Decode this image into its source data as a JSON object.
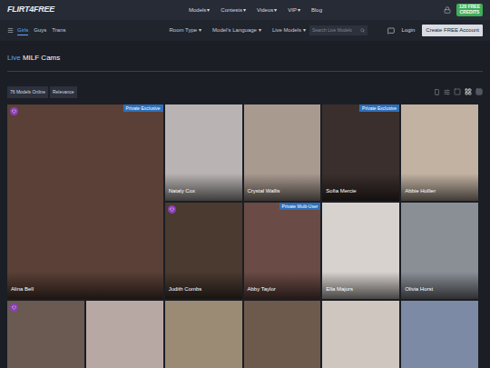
{
  "header": {
    "logo": "FLIRT4FREE",
    "nav": [
      {
        "label": "Models",
        "dropdown": true
      },
      {
        "label": "Contests",
        "dropdown": true
      },
      {
        "label": "Videos",
        "dropdown": true
      },
      {
        "label": "VIP",
        "dropdown": true
      },
      {
        "label": "Blog",
        "dropdown": false
      }
    ],
    "caret": "▾",
    "credits": {
      "amount": "120 FREE",
      "label": "CREDITS"
    }
  },
  "subbar": {
    "categories": [
      {
        "label": "Girls",
        "selected": true
      },
      {
        "label": "Guys",
        "selected": false
      },
      {
        "label": "Trans",
        "selected": false
      }
    ],
    "filters": [
      "Room Type",
      "Model's Language",
      "Live Models"
    ],
    "search": {
      "placeholder": "Search Live Models"
    },
    "login": "Login",
    "signup": "Create FREE Account"
  },
  "heading": {
    "accent": "Live",
    "rest": "MILF Cams"
  },
  "toolbar": {
    "count": "76 Models Online",
    "sort": "Relevance",
    "views": [
      {
        "selected": false
      },
      {
        "selected": true
      },
      {
        "selected": false
      }
    ]
  },
  "cards": [
    {
      "name": "Alina Bell",
      "badge": "Private Exclusive",
      "heart": true
    },
    {
      "name": "Nataly Cox",
      "badge": "",
      "heart": false
    },
    {
      "name": "Crystal Wallis",
      "badge": "",
      "heart": false
    },
    {
      "name": "Sofia Mercie",
      "badge": "Private Exclusive",
      "heart": false
    },
    {
      "name": "Abbie Hollier",
      "badge": "",
      "heart": false
    },
    {
      "name": "Judith Combs",
      "badge": "",
      "heart": true
    },
    {
      "name": "Abby Taylor",
      "badge": "Private Multi-User",
      "heart": false
    },
    {
      "name": "Ella Majors",
      "badge": "",
      "heart": false
    },
    {
      "name": "Olivia Horst",
      "badge": "",
      "heart": false
    },
    {
      "name": "",
      "badge": "",
      "heart": true
    },
    {
      "name": "",
      "badge": "",
      "heart": false
    },
    {
      "name": "",
      "badge": "",
      "heart": false
    },
    {
      "name": "",
      "badge": "",
      "heart": false
    },
    {
      "name": "",
      "badge": "",
      "heart": false
    },
    {
      "name": "",
      "badge": "",
      "heart": false
    }
  ]
}
